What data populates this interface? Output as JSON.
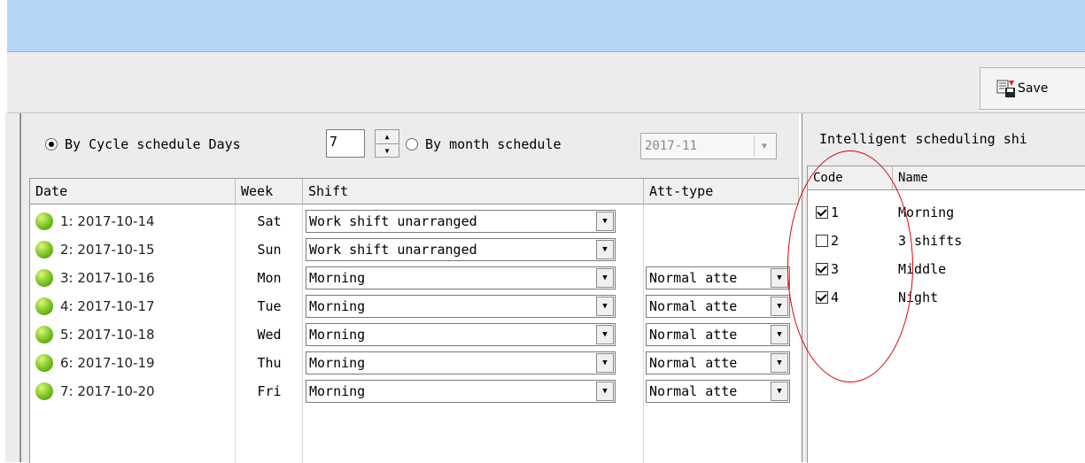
{
  "toolbar": {
    "save_label": "Save"
  },
  "options": {
    "cycle_label": "By Cycle schedule Days",
    "cycle_days": "7",
    "month_label": "By month schedule",
    "month_value": "2017-11"
  },
  "grid": {
    "columns": [
      "Date",
      "Week",
      "Shift",
      "Att-type"
    ],
    "rows": [
      {
        "date": "1: 2017-10-14",
        "week": "Sat",
        "shift": "Work shift unarranged",
        "att": ""
      },
      {
        "date": "2: 2017-10-15",
        "week": "Sun",
        "shift": "Work shift unarranged",
        "att": ""
      },
      {
        "date": "3: 2017-10-16",
        "week": "Mon",
        "shift": "Morning",
        "att": "Normal atte"
      },
      {
        "date": "4: 2017-10-17",
        "week": "Tue",
        "shift": "Morning",
        "att": "Normal atte"
      },
      {
        "date": "5: 2017-10-18",
        "week": "Wed",
        "shift": "Morning",
        "att": "Normal atte"
      },
      {
        "date": "6: 2017-10-19",
        "week": "Thu",
        "shift": "Morning",
        "att": "Normal atte"
      },
      {
        "date": "7: 2017-10-20",
        "week": "Fri",
        "shift": "Morning",
        "att": "Normal atte"
      }
    ]
  },
  "right": {
    "title": "Intelligent scheduling shi",
    "columns": [
      "Code",
      "Name"
    ],
    "rows": [
      {
        "code": "1",
        "name": "Morning",
        "checked": true
      },
      {
        "code": "2",
        "name": "3 shifts",
        "checked": false
      },
      {
        "code": "3",
        "name": "Middle",
        "checked": true
      },
      {
        "code": "4",
        "name": "Night",
        "checked": true
      }
    ]
  },
  "colors": {
    "titlebar": "#b6d6f8",
    "panel": "#ececec",
    "annotation": "#e00000",
    "status_ball": "#6fbd1b"
  },
  "icons": {
    "save": "save-disk-icon",
    "status": "green-ball-icon",
    "dropdown": "triangle-down-icon"
  }
}
